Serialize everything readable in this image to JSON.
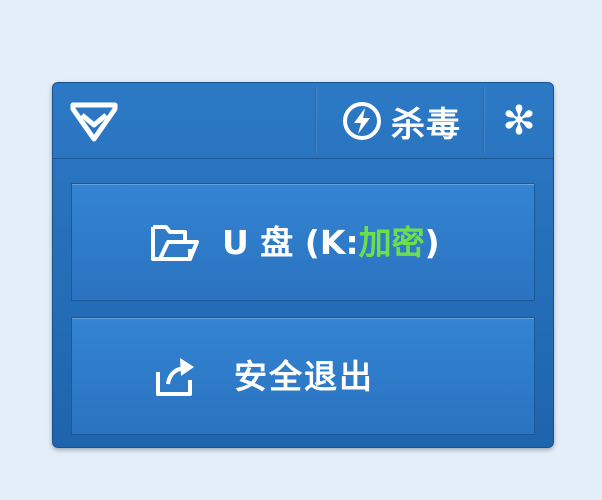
{
  "header": {
    "logo_icon": "shield-logo-icon",
    "kill_virus": {
      "label": "杀毒",
      "icon": "lightning-circle-icon"
    },
    "settings": {
      "icon": "gear-icon"
    }
  },
  "drives": [
    {
      "icon": "folder-open-icon",
      "name": "U 盘",
      "open": "(K:",
      "status": "加密",
      "close": ")",
      "status_color": "#6be04a"
    }
  ],
  "eject": {
    "icon": "export-arrow-icon",
    "label": "安全退出"
  },
  "colors": {
    "background": "#e3eef9",
    "panel": "#2c79c5",
    "accent": "#6be04a"
  }
}
